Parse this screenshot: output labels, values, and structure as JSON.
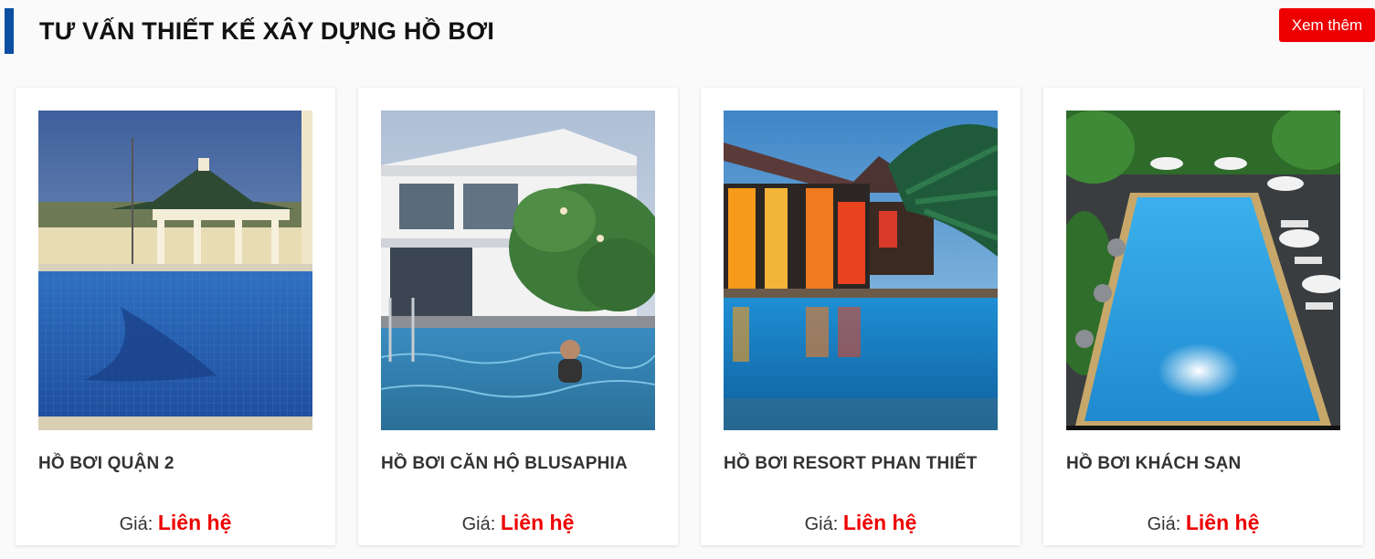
{
  "header": {
    "title": "TƯ VẤN THIẾT KẾ XÂY DỰNG HỒ BƠI",
    "more_label": "Xem thêm"
  },
  "products": [
    {
      "title": "HỒ BƠI QUẬN 2",
      "price_label": "Giá:",
      "price_value": "Liên hệ"
    },
    {
      "title": "HỒ BƠI CĂN HỘ BLUSAPHIA",
      "price_label": "Giá:",
      "price_value": "Liên hệ"
    },
    {
      "title": "HỒ BƠI RESORT PHAN THIẾT",
      "price_label": "Giá:",
      "price_value": "Liên hệ"
    },
    {
      "title": "HỒ BƠI KHÁCH SẠN",
      "price_label": "Giá:",
      "price_value": "Liên hệ"
    }
  ],
  "colors": {
    "accent_bar": "#0b4ea2",
    "button_bg": "#ee0000",
    "price_value": "#ee0000"
  }
}
